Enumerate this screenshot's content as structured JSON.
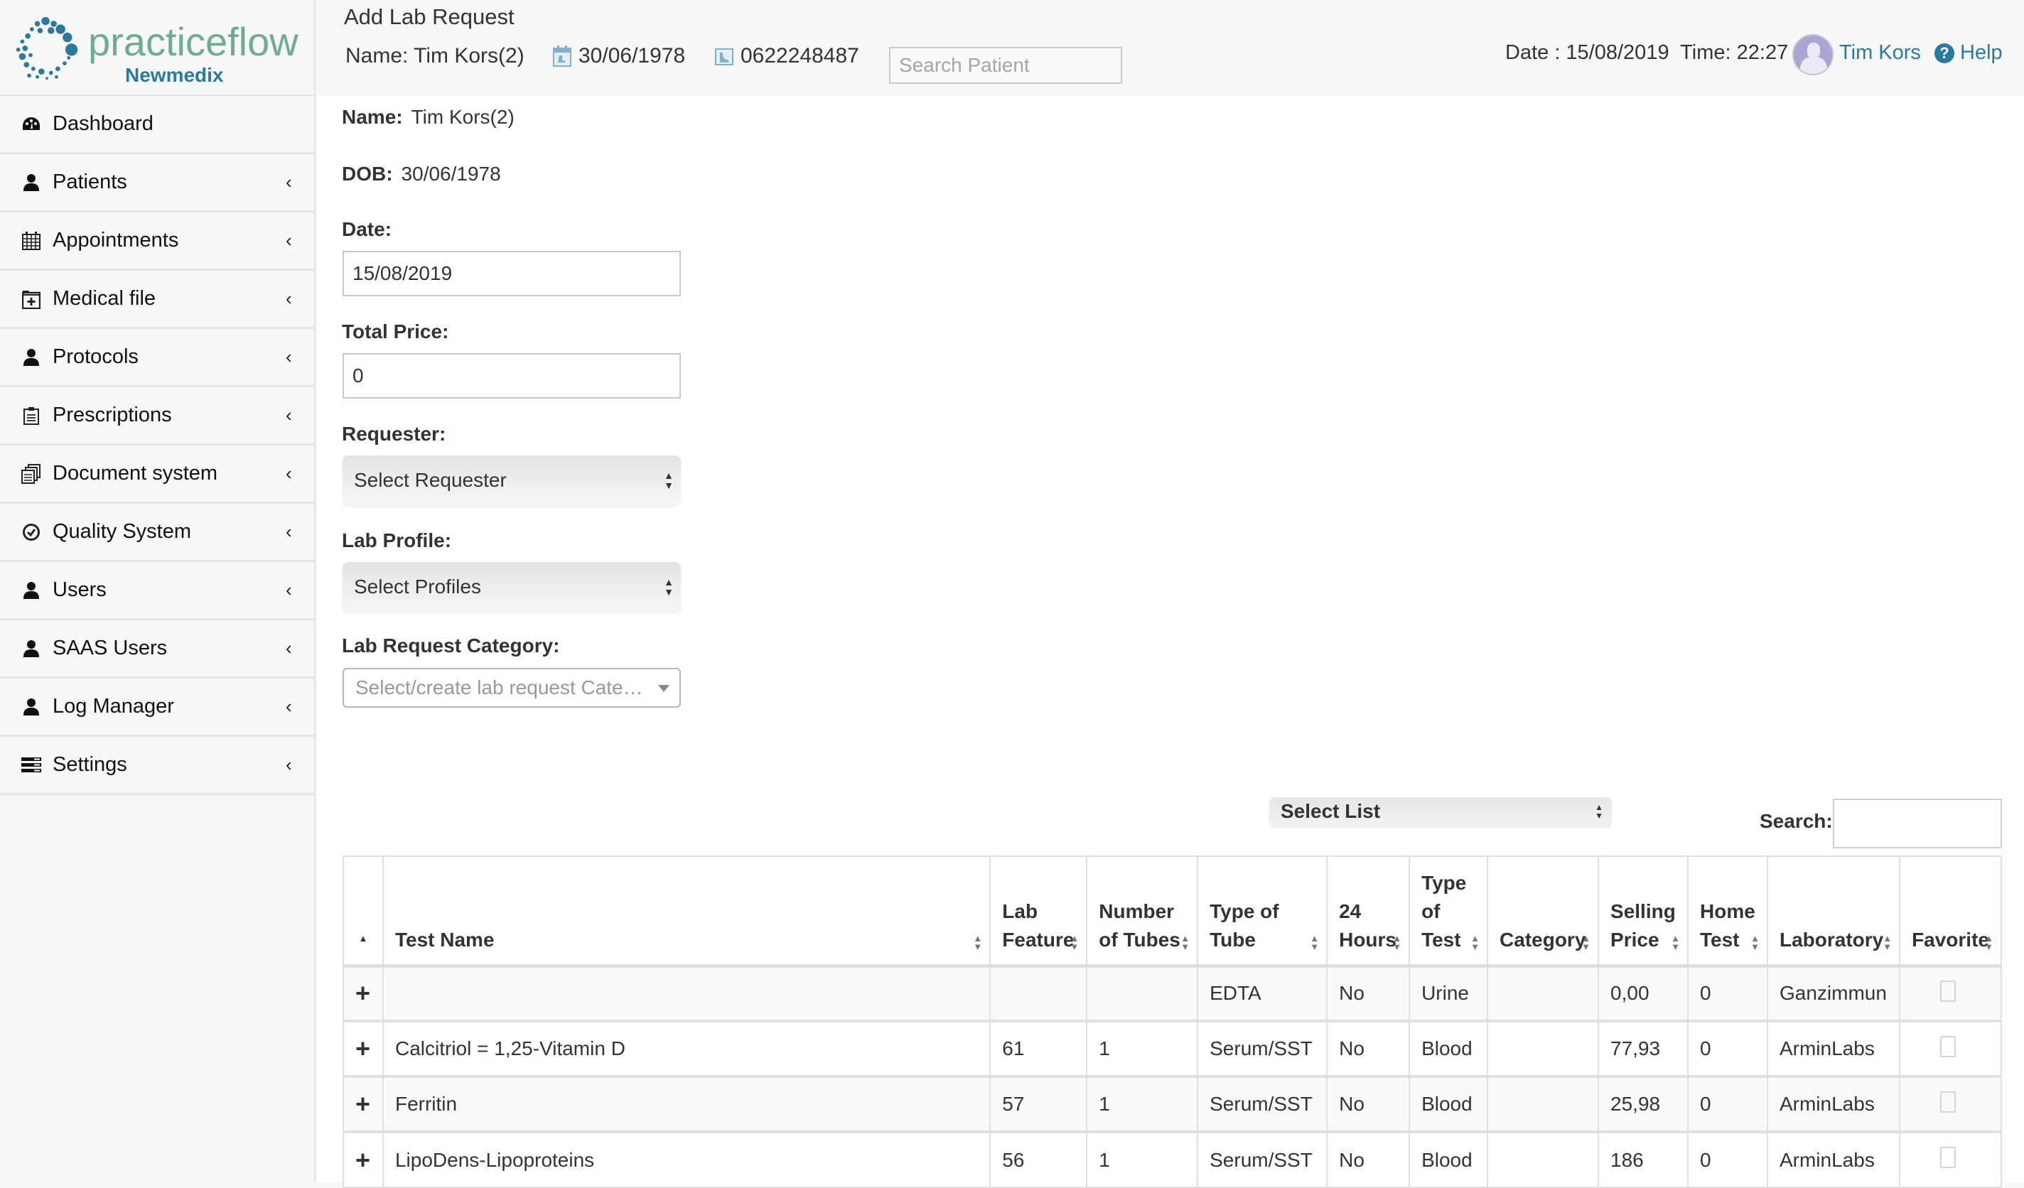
{
  "brand": {
    "name": "practiceflow",
    "subtitle": "Newmedix",
    "logo_color": "#2a7a9e",
    "name_color": "#6bae8e"
  },
  "header": {
    "title": "Add Lab Request",
    "patient_name": "Name: Tim Kors(2)",
    "patient_dob": "30/06/1978",
    "patient_phone": "0622248487",
    "search_placeholder": "Search Patient",
    "date_time": "Date : 15/08/2019  Time: 22:27",
    "user_name": "Tim Kors",
    "help_label": "Help",
    "accent_color": "#2a7a9e"
  },
  "sidebar": {
    "items": [
      {
        "label": "Dashboard",
        "icon": "dashboard-icon",
        "chevron": false
      },
      {
        "label": "Patients",
        "icon": "user-icon",
        "chevron": true
      },
      {
        "label": "Appointments",
        "icon": "calendar-icon",
        "chevron": true
      },
      {
        "label": "Medical file",
        "icon": "medical-file-icon",
        "chevron": true
      },
      {
        "label": "Protocols",
        "icon": "user-icon",
        "chevron": true
      },
      {
        "label": "Prescriptions",
        "icon": "clipboard-icon",
        "chevron": true
      },
      {
        "label": "Document system",
        "icon": "documents-icon",
        "chevron": true
      },
      {
        "label": "Quality System",
        "icon": "check-circle-icon",
        "chevron": true
      },
      {
        "label": "Users",
        "icon": "user-icon",
        "chevron": true
      },
      {
        "label": "SAAS Users",
        "icon": "user-icon",
        "chevron": true
      },
      {
        "label": "Log Manager",
        "icon": "user-icon",
        "chevron": true
      },
      {
        "label": "Settings",
        "icon": "settings-icon",
        "chevron": true
      }
    ],
    "chevron_glyph": "‹"
  },
  "form": {
    "name_label": "Name:",
    "name_value": "Tim Kors(2)",
    "dob_label": "DOB:",
    "dob_value": "30/06/1978",
    "date_label": "Date:",
    "date_value": "15/08/2019",
    "total_price_label": "Total Price:",
    "total_price_value": "0",
    "requester_label": "Requester:",
    "requester_selected": "Select Requester",
    "lab_profile_label": "Lab Profile:",
    "lab_profile_selected": "Select Profiles",
    "category_label": "Lab Request Category:",
    "category_placeholder": "Select/create lab request Cate…"
  },
  "table_controls": {
    "list_selected": "Select List",
    "search_label": "Search:",
    "search_value": ""
  },
  "table": {
    "columns": [
      {
        "label": "Test Name"
      },
      {
        "label": "Lab Feature"
      },
      {
        "label": "Number of Tubes"
      },
      {
        "label": "Type of Tube"
      },
      {
        "label": "24 Hours"
      },
      {
        "label": "Type of Test"
      },
      {
        "label": "Category"
      },
      {
        "label": "Selling Price"
      },
      {
        "label": "Home Test"
      },
      {
        "label": "Laboratory"
      },
      {
        "label": "Favorite"
      }
    ],
    "rows": [
      {
        "test_name": "",
        "lab_feature": "",
        "tubes": "",
        "tube_type": "EDTA",
        "hours24": "No",
        "test_type": "Urine",
        "category": "",
        "price": "0,00",
        "home_test": "0",
        "laboratory": "Ganzimmun",
        "favorite": false
      },
      {
        "test_name": "Calcitriol = 1,25-Vitamin D",
        "lab_feature": "61",
        "tubes": "1",
        "tube_type": "Serum/SST",
        "hours24": "No",
        "test_type": "Blood",
        "category": "",
        "price": "77,93",
        "home_test": "0",
        "laboratory": "ArminLabs",
        "favorite": false
      },
      {
        "test_name": "Ferritin",
        "lab_feature": "57",
        "tubes": "1",
        "tube_type": "Serum/SST",
        "hours24": "No",
        "test_type": "Blood",
        "category": "",
        "price": "25,98",
        "home_test": "0",
        "laboratory": "ArminLabs",
        "favorite": false
      },
      {
        "test_name": "LipoDens-Lipoproteins",
        "lab_feature": "56",
        "tubes": "1",
        "tube_type": "Serum/SST",
        "hours24": "No",
        "test_type": "Blood",
        "category": "",
        "price": "186",
        "home_test": "0",
        "laboratory": "ArminLabs",
        "favorite": false
      }
    ]
  }
}
